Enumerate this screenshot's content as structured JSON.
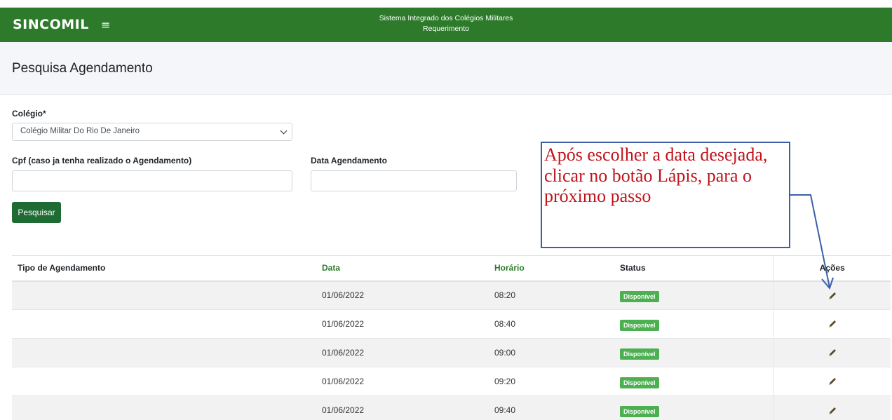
{
  "header": {
    "brand": "SINCOMIL",
    "menu_icon": "hamburger-icon",
    "system_title": "Sistema Integrado dos Colégios Militares",
    "system_subtitle": "Requerimento",
    "color": "#2d7b2a"
  },
  "page": {
    "title": "Pesquisa Agendamento"
  },
  "form": {
    "colegio_label": "Colégio*",
    "colegio_value": "Colégio Militar Do Rio De Janeiro",
    "cpf_label": "Cpf (caso ja tenha realizado o Agendamento)",
    "cpf_value": "",
    "data_label": "Data Agendamento",
    "data_value": "",
    "search_button": "Pesquisar"
  },
  "callout": {
    "text": "Após escolher a data desejada, clicar no botão Lápis, para o próximo passo",
    "text_color": "#c0141b",
    "border_color": "#3a5fa8"
  },
  "table": {
    "headers": [
      "Tipo de Agendamento",
      "Data",
      "Horário",
      "Status",
      "Ações"
    ],
    "rows": [
      {
        "tipo": "",
        "data": "01/06/2022",
        "horario": "08:20",
        "status": "Disponível",
        "action_icon": "pencil-icon"
      },
      {
        "tipo": "",
        "data": "01/06/2022",
        "horario": "08:40",
        "status": "Disponível",
        "action_icon": "pencil-icon"
      },
      {
        "tipo": "",
        "data": "01/06/2022",
        "horario": "09:00",
        "status": "Disponível",
        "action_icon": "pencil-icon"
      },
      {
        "tipo": "",
        "data": "01/06/2022",
        "horario": "09:20",
        "status": "Disponível",
        "action_icon": "pencil-icon"
      },
      {
        "tipo": "",
        "data": "01/06/2022",
        "horario": "09:40",
        "status": "Disponível",
        "action_icon": "pencil-icon"
      }
    ],
    "status_color": "#4caf50"
  }
}
